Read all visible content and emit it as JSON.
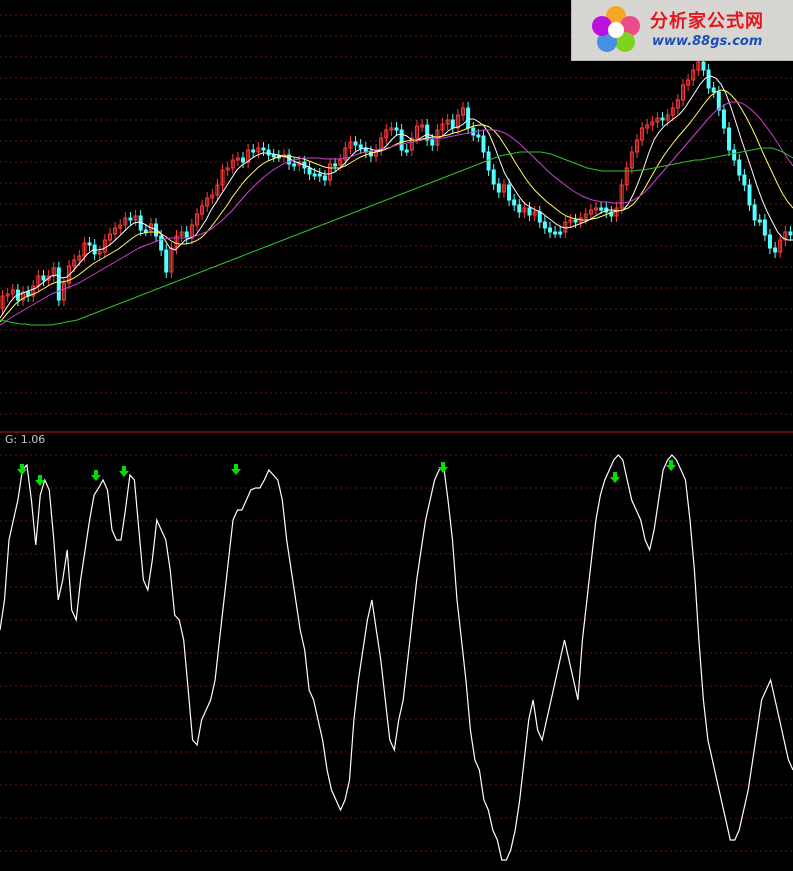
{
  "logo": {
    "cn_text": "分析家公式网",
    "url": "www.88gs.com"
  },
  "indicator": {
    "label": "G: 1.06"
  },
  "chart_data": [
    {
      "type": "candlestick",
      "panel": "price",
      "title": "",
      "candles_open": [
        308,
        296,
        294,
        290,
        300,
        292,
        296,
        286,
        276,
        280,
        276,
        268,
        300,
        283,
        266,
        260,
        256,
        243,
        245,
        254,
        252,
        240,
        234,
        228,
        225,
        218,
        220,
        216,
        230,
        230,
        224,
        236,
        250,
        272,
        248,
        236,
        232,
        238,
        225,
        214,
        206,
        198,
        195,
        185,
        170,
        168,
        160,
        158,
        162,
        150,
        152,
        148,
        150,
        155,
        156,
        156,
        155,
        164,
        165,
        162,
        168,
        174,
        174,
        176,
        180,
        164,
        165,
        160,
        148,
        142,
        145,
        148,
        152,
        156,
        150,
        138,
        130,
        128,
        130,
        150,
        150,
        138,
        126,
        125,
        140,
        145,
        130,
        124,
        120,
        128,
        115,
        108,
        128,
        135,
        136,
        152,
        170,
        184,
        192,
        185,
        200,
        205,
        212,
        208,
        215,
        212,
        222,
        228,
        232,
        232,
        232,
        222,
        220,
        222,
        218,
        214,
        210,
        208,
        208,
        212,
        216,
        208,
        185,
        168,
        152,
        140,
        128,
        125,
        122,
        118,
        120,
        115,
        108,
        100,
        85,
        80,
        70,
        62,
        70,
        88,
        92,
        110,
        128,
        150,
        160,
        175,
        185,
        205,
        220,
        220,
        235,
        248,
        252,
        240,
        232
      ],
      "candles_close": [
        296,
        294,
        290,
        300,
        292,
        296,
        286,
        276,
        280,
        276,
        268,
        300,
        283,
        266,
        260,
        256,
        243,
        245,
        254,
        252,
        240,
        234,
        228,
        225,
        218,
        220,
        216,
        230,
        230,
        224,
        236,
        250,
        272,
        248,
        236,
        232,
        238,
        225,
        214,
        206,
        198,
        195,
        185,
        170,
        168,
        160,
        158,
        162,
        150,
        152,
        148,
        150,
        155,
        156,
        156,
        155,
        164,
        165,
        162,
        168,
        174,
        174,
        176,
        180,
        164,
        165,
        160,
        148,
        142,
        145,
        148,
        152,
        156,
        150,
        138,
        130,
        128,
        130,
        150,
        150,
        138,
        126,
        125,
        140,
        145,
        130,
        124,
        120,
        128,
        115,
        108,
        128,
        135,
        136,
        152,
        170,
        184,
        192,
        185,
        200,
        205,
        212,
        208,
        215,
        212,
        222,
        228,
        232,
        232,
        232,
        222,
        220,
        222,
        218,
        214,
        210,
        208,
        208,
        212,
        216,
        208,
        185,
        168,
        152,
        140,
        128,
        125,
        122,
        118,
        120,
        115,
        108,
        100,
        85,
        80,
        70,
        62,
        70,
        88,
        92,
        110,
        128,
        150,
        160,
        175,
        185,
        205,
        220,
        220,
        235,
        248,
        252,
        240,
        232,
        235
      ],
      "moving_averages": [
        {
          "color": "#ffffff",
          "values": [
            318,
            310,
            302,
            296,
            294,
            292,
            290,
            288,
            284,
            280,
            276,
            275,
            278,
            277,
            272,
            266,
            260,
            254,
            250,
            250,
            249,
            246,
            242,
            237,
            232,
            227,
            223,
            222,
            224,
            227,
            229,
            232,
            240,
            248,
            250,
            245,
            240,
            238,
            235,
            228,
            220,
            210,
            202,
            194,
            186,
            178,
            170,
            165,
            162,
            158,
            155,
            153,
            153,
            154,
            155,
            156,
            158,
            161,
            163,
            165,
            167,
            170,
            172,
            174,
            174,
            172,
            168,
            163,
            157,
            152,
            149,
            148,
            149,
            151,
            150,
            146,
            140,
            135,
            134,
            136,
            140,
            140,
            137,
            134,
            136,
            138,
            136,
            131,
            128,
            127,
            124,
            119,
            119,
            122,
            126,
            134,
            146,
            160,
            173,
            182,
            190,
            198,
            204,
            207,
            210,
            212,
            216,
            220,
            224,
            227,
            228,
            227,
            225,
            223,
            221,
            218,
            215,
            212,
            210,
            210,
            211,
            210,
            204,
            194,
            182,
            168,
            153,
            140,
            132,
            126,
            122,
            118,
            114,
            108,
            100,
            92,
            84,
            78,
            76,
            78,
            84,
            94,
            108,
            124,
            140,
            155,
            170,
            186,
            200,
            212,
            222,
            232,
            238,
            240,
            240
          ]
        },
        {
          "color": "#ffff66",
          "values": [
            322,
            316,
            310,
            304,
            300,
            297,
            295,
            293,
            290,
            287,
            284,
            282,
            282,
            281,
            279,
            276,
            272,
            268,
            264,
            261,
            258,
            255,
            252,
            249,
            245,
            241,
            237,
            234,
            233,
            232,
            232,
            233,
            236,
            240,
            243,
            244,
            244,
            243,
            241,
            238,
            233,
            227,
            220,
            213,
            206,
            198,
            191,
            184,
            178,
            173,
            168,
            164,
            161,
            159,
            157,
            156,
            156,
            157,
            158,
            159,
            161,
            163,
            165,
            167,
            168,
            168,
            168,
            166,
            163,
            160,
            157,
            155,
            153,
            152,
            151,
            149,
            147,
            144,
            142,
            141,
            140,
            140,
            139,
            138,
            137,
            137,
            136,
            135,
            133,
            132,
            130,
            128,
            126,
            125,
            125,
            127,
            131,
            137,
            145,
            153,
            162,
            170,
            178,
            185,
            191,
            196,
            201,
            205,
            209,
            213,
            216,
            218,
            219,
            220,
            220,
            219,
            218,
            216,
            214,
            212,
            211,
            210,
            208,
            204,
            198,
            190,
            181,
            172,
            163,
            155,
            148,
            141,
            135,
            129,
            123,
            116,
            109,
            102,
            96,
            92,
            90,
            91,
            95,
            101,
            109,
            118,
            128,
            139,
            151,
            162,
            173,
            184,
            194,
            202,
            208
          ]
        },
        {
          "color": "#d040d0",
          "values": [
            325,
            322,
            318,
            315,
            312,
            309,
            306,
            303,
            300,
            297,
            294,
            292,
            290,
            288,
            286,
            284,
            281,
            278,
            275,
            272,
            269,
            266,
            263,
            260,
            257,
            254,
            251,
            248,
            246,
            244,
            242,
            240,
            239,
            238,
            238,
            238,
            238,
            237,
            236,
            234,
            232,
            229,
            225,
            221,
            216,
            211,
            205,
            199,
            193,
            188,
            183,
            178,
            174,
            170,
            167,
            164,
            162,
            160,
            159,
            158,
            158,
            158,
            158,
            159,
            159,
            159,
            159,
            158,
            157,
            155,
            153,
            152,
            151,
            150,
            149,
            148,
            147,
            145,
            144,
            143,
            142,
            141,
            140,
            139,
            139,
            138,
            138,
            137,
            136,
            135,
            134,
            133,
            132,
            131,
            130,
            130,
            130,
            131,
            133,
            136,
            140,
            144,
            149,
            154,
            159,
            164,
            169,
            174,
            178,
            182,
            186,
            190,
            193,
            196,
            198,
            200,
            201,
            202,
            202,
            203,
            203,
            203,
            202,
            200,
            197,
            193,
            188,
            182,
            176,
            170,
            164,
            158,
            152,
            146,
            140,
            134,
            128,
            122,
            116,
            111,
            107,
            104,
            102,
            102,
            103,
            106,
            110,
            115,
            121,
            128,
            135,
            143,
            151,
            159,
            166
          ]
        },
        {
          "color": "#30c030",
          "values": [
            320,
            321,
            322,
            323,
            324,
            324,
            325,
            325,
            325,
            325,
            325,
            324,
            323,
            322,
            321,
            320,
            318,
            316,
            314,
            312,
            310,
            308,
            306,
            304,
            302,
            300,
            298,
            296,
            294,
            292,
            290,
            288,
            286,
            284,
            282,
            280,
            278,
            276,
            274,
            272,
            270,
            268,
            266,
            264,
            262,
            260,
            258,
            256,
            254,
            252,
            250,
            248,
            246,
            244,
            242,
            240,
            238,
            236,
            234,
            232,
            230,
            228,
            226,
            224,
            222,
            220,
            218,
            216,
            214,
            212,
            210,
            208,
            206,
            204,
            202,
            200,
            198,
            196,
            194,
            192,
            190,
            188,
            186,
            184,
            182,
            180,
            178,
            176,
            174,
            172,
            170,
            168,
            166,
            164,
            162,
            160,
            158,
            156,
            155,
            154,
            153,
            152,
            152,
            152,
            152,
            152,
            153,
            154,
            156,
            158,
            160,
            162,
            164,
            166,
            168,
            169,
            170,
            171,
            171,
            171,
            171,
            171,
            171,
            171,
            170,
            170,
            169,
            168,
            167,
            166,
            165,
            164,
            163,
            162,
            161,
            160,
            160,
            159,
            158,
            157,
            156,
            155,
            154,
            153,
            152,
            151,
            150,
            149,
            148,
            148,
            148,
            150,
            152,
            155,
            158
          ]
        }
      ]
    },
    {
      "type": "line",
      "panel": "indicator",
      "series": [
        {
          "name": "G",
          "color": "#ffffff",
          "values": [
            630,
            600,
            540,
            520,
            500,
            470,
            465,
            500,
            545,
            495,
            480,
            490,
            540,
            600,
            580,
            550,
            610,
            620,
            580,
            550,
            520,
            495,
            488,
            480,
            490,
            530,
            540,
            540,
            510,
            475,
            480,
            530,
            580,
            590,
            560,
            520,
            530,
            540,
            570,
            615,
            620,
            640,
            690,
            740,
            745,
            720,
            710,
            700,
            680,
            640,
            600,
            560,
            520,
            510,
            510,
            500,
            490,
            488,
            488,
            480,
            470,
            475,
            480,
            500,
            540,
            570,
            600,
            630,
            650,
            690,
            700,
            720,
            740,
            770,
            790,
            800,
            810,
            800,
            780,
            720,
            680,
            650,
            620,
            600,
            630,
            660,
            700,
            740,
            750,
            720,
            700,
            660,
            620,
            580,
            550,
            520,
            500,
            480,
            470,
            465,
            500,
            540,
            600,
            640,
            680,
            730,
            760,
            770,
            800,
            810,
            830,
            840,
            860,
            860,
            850,
            830,
            800,
            760,
            720,
            700,
            730,
            740,
            720,
            700,
            680,
            660,
            640,
            660,
            680,
            700,
            640,
            600,
            560,
            520,
            495,
            480,
            470,
            460,
            455,
            460,
            480,
            500,
            510,
            520,
            540,
            550,
            530,
            500,
            470,
            460,
            455,
            460,
            470,
            480,
            520,
            570,
            640,
            700,
            740,
            760,
            780,
            800,
            820,
            840,
            840,
            830,
            810,
            790,
            760,
            730,
            700,
            690,
            680,
            700,
            720,
            740,
            760,
            770
          ]
        },
        {
          "name": "",
          "color": "#00ff00",
          "markers_only": true,
          "values": []
        }
      ]
    }
  ]
}
